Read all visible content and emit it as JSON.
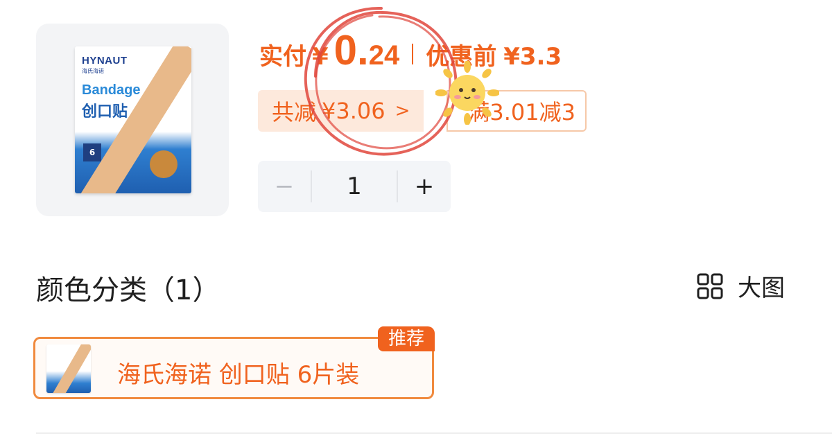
{
  "product": {
    "image_alt": "product-thumbnail",
    "package": {
      "logo": "HYNAUT",
      "logo_sub": "海氏海诺",
      "brand": "Bandage",
      "name_cn": "创口贴",
      "count": "6"
    }
  },
  "price": {
    "paid_label": "实付",
    "currency": "¥",
    "paid_integer": "0.",
    "paid_decimal": "24",
    "before_label": "优惠前",
    "before_value": "¥3.3"
  },
  "discount": {
    "saved_label": "共减",
    "saved_value": "¥3.06",
    "saved_chevron": ">",
    "coupon_text": "满3.01减3"
  },
  "quantity": {
    "minus": "−",
    "value": "1",
    "plus": "+"
  },
  "section": {
    "title": "颜色分类（1）",
    "bigview_label": "大图"
  },
  "variants": [
    {
      "label": "海氏海诺 创口贴 6片装",
      "badge": "推荐"
    }
  ],
  "colors": {
    "accent": "#f0621e",
    "tag_bg": "#fde9dc",
    "variant_border": "#f08a3e",
    "scribble": "#e0463c"
  },
  "icons": [
    "grid-view-icon",
    "chevron-right-icon",
    "sun-sticker"
  ]
}
